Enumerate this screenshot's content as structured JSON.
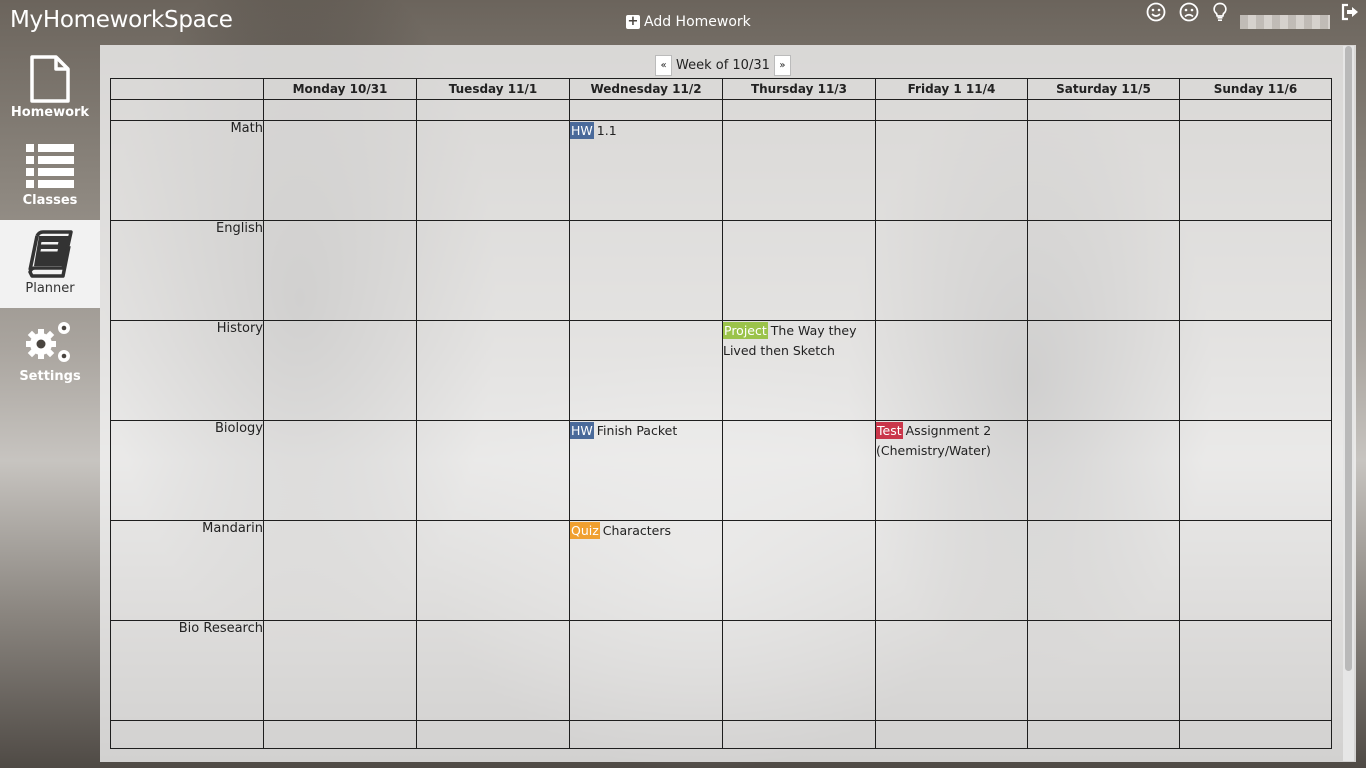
{
  "app": {
    "title": "MyHomeworkSpace"
  },
  "header": {
    "add_label": "Add Homework",
    "icons": [
      "smile-icon",
      "frown-icon",
      "lightbulb-icon",
      "logout-icon"
    ]
  },
  "sidebar": {
    "items": [
      {
        "label": "Homework",
        "icon": "file-icon"
      },
      {
        "label": "Classes",
        "icon": "list-icon"
      },
      {
        "label": "Planner",
        "icon": "book-icon"
      },
      {
        "label": "Settings",
        "icon": "gears-icon"
      }
    ],
    "active": "Planner"
  },
  "planner": {
    "week_label": "Week of 10/31",
    "prev_label": "«",
    "next_label": "»",
    "days": [
      "Monday 10/31",
      "Tuesday 11/1",
      "Wednesday 11/2",
      "Thursday 11/3",
      "Friday 1 11/4",
      "Saturday 11/5",
      "Sunday 11/6"
    ],
    "classes": [
      {
        "name": "Math",
        "items": [
          {
            "day": 2,
            "tag": "HW",
            "text": "1.1"
          }
        ]
      },
      {
        "name": "English",
        "items": []
      },
      {
        "name": "History",
        "items": [
          {
            "day": 3,
            "tag": "Project",
            "text": "The Way they Lived then Sketch"
          }
        ]
      },
      {
        "name": "Biology",
        "items": [
          {
            "day": 2,
            "tag": "HW",
            "text": "Finish Packet"
          },
          {
            "day": 4,
            "tag": "Test",
            "text": "Assignment 2 (Chemistry/Water)"
          }
        ]
      },
      {
        "name": "Mandarin",
        "items": [
          {
            "day": 2,
            "tag": "Quiz",
            "text": "Characters"
          }
        ]
      },
      {
        "name": "Bio Research",
        "items": []
      }
    ]
  },
  "colors": {
    "HW": "#4a6a9a",
    "Project": "#9bc34a",
    "Test": "#c9364a",
    "Quiz": "#f0a030"
  }
}
